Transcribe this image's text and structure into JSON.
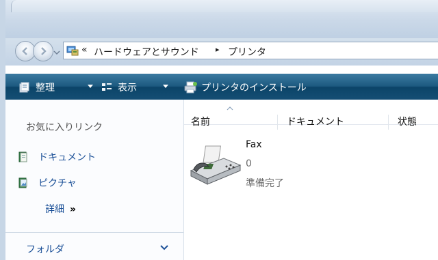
{
  "address": {
    "chevron": "«",
    "crumbs": [
      "ハードウェアとサウンド",
      "プリンタ"
    ],
    "separator": "▸",
    "icon": "control-panel-icon"
  },
  "toolbar": {
    "organize": "整理",
    "view": "表示",
    "install": "プリンタのインストール"
  },
  "navpane": {
    "favorites_title": "お気に入りリンク",
    "items": [
      {
        "label": "ドキュメント",
        "icon": "documents-icon"
      },
      {
        "label": "ピクチャ",
        "icon": "pictures-icon"
      }
    ],
    "more": "詳細",
    "more_glyph": "»",
    "folders": "フォルダ"
  },
  "columns": [
    "名前",
    "ドキュメント",
    "状態"
  ],
  "printers": [
    {
      "name": "Fax",
      "documents": "0",
      "status": "準備完了",
      "icon": "fax-printer-icon"
    }
  ]
}
